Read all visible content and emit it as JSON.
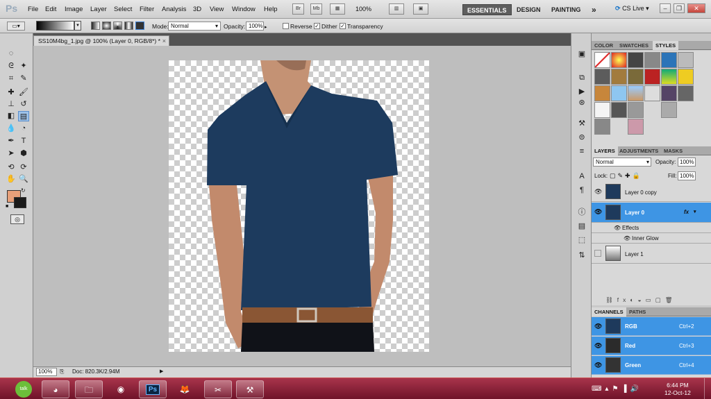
{
  "app": {
    "logo": "Ps"
  },
  "menu": [
    "File",
    "Edit",
    "Image",
    "Layer",
    "Select",
    "Filter",
    "Analysis",
    "3D",
    "View",
    "Window",
    "Help"
  ],
  "menubar": {
    "br_label": "Br",
    "mb_label": "Mb",
    "zoom": "100%",
    "workspaces": [
      "ESSENTIALS",
      "DESIGN",
      "PAINTING"
    ],
    "more": "»",
    "cslive": "CS Live"
  },
  "options": {
    "mode_label": "Mode:",
    "mode_value": "Normal",
    "opacity_label": "Opacity:",
    "opacity_value": "100%",
    "reverse_label": "Reverse",
    "dither_label": "Dither",
    "transparency_label": "Transparency",
    "reverse": false,
    "dither": true,
    "transparency": true
  },
  "document": {
    "tab_title": "SS10M4bg_1.jpg @ 100% (Layer 0, RGB/8*) *",
    "close": "×"
  },
  "status": {
    "zoom": "100%",
    "doc": "Doc: 820.3K/2.94M"
  },
  "colors": {
    "foreground": "#e8a07a",
    "background": "#1a1a1a",
    "selection": "#3e95e4"
  },
  "styles_panel": {
    "tabs": [
      "COLOR",
      "SWATCHES",
      "STYLES"
    ]
  },
  "layers_panel": {
    "tabs": [
      "LAYERS",
      "ADJUSTMENTS",
      "MASKS"
    ],
    "blend_mode": "Normal",
    "opacity_label": "Opacity:",
    "opacity_value": "100%",
    "lock_label": "Lock:",
    "fill_label": "Fill:",
    "fill_value": "100%",
    "layers": [
      {
        "name": "Layer 0 copy"
      },
      {
        "name": "Layer 0"
      },
      {
        "name": "Effects"
      },
      {
        "name": "Inner Glow"
      },
      {
        "name": "Layer 1"
      }
    ]
  },
  "channels_panel": {
    "tabs": [
      "CHANNELS",
      "PATHS"
    ],
    "channels": [
      {
        "name": "RGB",
        "shortcut": "Ctrl+2"
      },
      {
        "name": "Red",
        "shortcut": "Ctrl+3"
      },
      {
        "name": "Green",
        "shortcut": "Ctrl+4"
      }
    ]
  },
  "taskbar": {
    "apps": [
      "talk",
      "chrome-app",
      "explorer",
      "chrome",
      "Ps",
      "firefox",
      "snipping",
      "tool"
    ],
    "time": "6:44 PM",
    "date": "12-Oct-12"
  }
}
